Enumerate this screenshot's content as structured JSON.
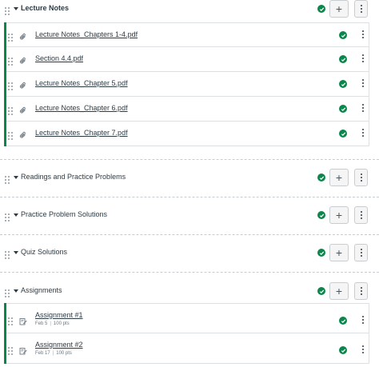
{
  "modules": [
    {
      "title": "Lecture Notes",
      "items": [
        {
          "title": "Lecture Notes_Chapters 1-4.pdf",
          "icon": "attachment-icon"
        },
        {
          "title": "Section 4.4.pdf",
          "icon": "attachment-icon"
        },
        {
          "title": "Lecture Notes_Chapter 5.pdf",
          "icon": "attachment-icon"
        },
        {
          "title": "Lecture Notes_Chapter 6.pdf",
          "icon": "attachment-icon"
        },
        {
          "title": "Lecture Notes_Chapter 7.pdf",
          "icon": "attachment-icon"
        }
      ]
    },
    {
      "title": "Readings and Practice Problems",
      "items": []
    },
    {
      "title": "Practice Problem Solutions",
      "items": []
    },
    {
      "title": "Quiz Solutions",
      "items": []
    },
    {
      "title": "Assignments",
      "items": [
        {
          "title": "Assignment #1",
          "date": "Feb 5",
          "points": "100 pts",
          "icon": "assignment-icon"
        },
        {
          "title": "Assignment #2",
          "date": "Feb 17",
          "points": "100 pts",
          "icon": "assignment-icon"
        }
      ]
    }
  ],
  "colors": {
    "published": "#0b874b",
    "text": "#2d3b45"
  }
}
